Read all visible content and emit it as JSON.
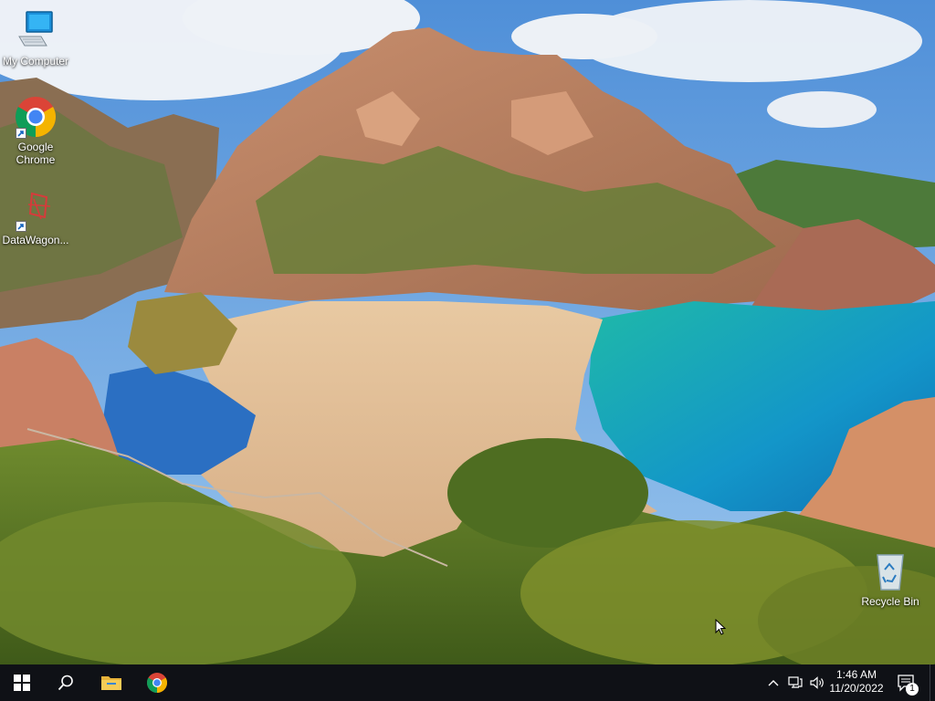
{
  "desktop": {
    "icons": [
      {
        "label": "My Computer",
        "icon": "computer-icon"
      },
      {
        "label": "Google Chrome",
        "icon": "chrome-icon"
      },
      {
        "label": "DataWagon...",
        "icon": "datawagon-icon"
      },
      {
        "label": "Recycle Bin",
        "icon": "recycle-bin-icon"
      }
    ]
  },
  "taskbar": {
    "pinned": [
      {
        "name": "Start",
        "icon": "windows-logo-icon"
      },
      {
        "name": "Search",
        "icon": "search-icon"
      },
      {
        "name": "File Explorer",
        "icon": "folder-icon"
      },
      {
        "name": "Google Chrome",
        "icon": "chrome-icon"
      }
    ],
    "tray": {
      "time": "1:46 AM",
      "date": "11/20/2022",
      "notification_count": "1"
    }
  },
  "colors": {
    "taskbar_bg": "#0f1116",
    "accent_blue": "#1e88e5"
  }
}
